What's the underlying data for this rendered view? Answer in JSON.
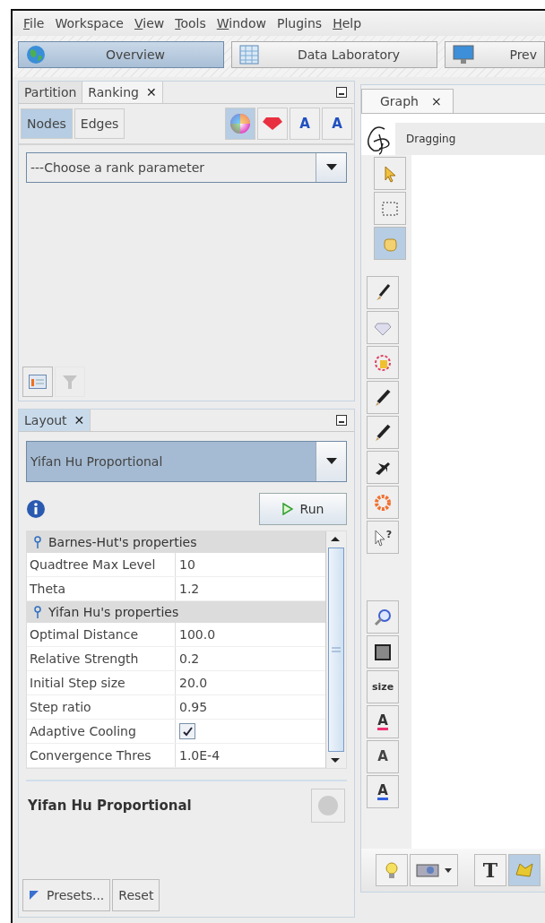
{
  "menu": [
    {
      "label": "File",
      "mnemonic": true
    },
    {
      "label": "Workspace",
      "mnemonic": false
    },
    {
      "label": "View",
      "mnemonic": true
    },
    {
      "label": "Tools",
      "mnemonic": true
    },
    {
      "label": "Window",
      "mnemonic": true
    },
    {
      "label": "Plugins",
      "mnemonic": false
    },
    {
      "label": "Help",
      "mnemonic": true
    }
  ],
  "perspectives": [
    {
      "label": "Overview",
      "kind": "globe",
      "selected": true
    },
    {
      "label": "Data Laboratory",
      "kind": "table",
      "selected": false
    },
    {
      "label": "Prev",
      "kind": "monitor",
      "selected": false
    }
  ],
  "ranking_panel": {
    "tabs": [
      {
        "label": "Partition",
        "selected": false,
        "closable": false
      },
      {
        "label": "Ranking",
        "selected": true,
        "closable": true
      }
    ],
    "close": "✕",
    "element_tabs": [
      {
        "label": "Nodes",
        "selected": true
      },
      {
        "label": "Edges",
        "selected": false
      }
    ],
    "transformers": [
      {
        "kind": "color",
        "selected": true
      },
      {
        "kind": "size",
        "selected": false
      },
      {
        "kind": "label-color",
        "glyph": "A",
        "selected": false
      },
      {
        "kind": "label-size",
        "glyph": "A",
        "selected": false
      }
    ],
    "combo": {
      "value": "---Choose a rank parameter"
    },
    "bottom_buttons": [
      {
        "kind": "list",
        "disabled": false
      },
      {
        "kind": "filter",
        "disabled": true
      }
    ]
  },
  "layout_panel": {
    "tab": {
      "label": "Layout",
      "close": "✕",
      "selected": true
    },
    "combo": {
      "value": "Yifan Hu Proportional"
    },
    "run": "Run",
    "sections": [
      {
        "title": "Barnes-Hut's properties",
        "rows": [
          {
            "kind": "text",
            "name": "Quadtree Max Level",
            "value": "10"
          },
          {
            "kind": "text",
            "name": "Theta",
            "value": "1.2"
          }
        ]
      },
      {
        "title": "Yifan Hu's properties",
        "rows": [
          {
            "kind": "text",
            "name": "Optimal Distance",
            "value": "100.0"
          },
          {
            "kind": "text",
            "name": "Relative Strength",
            "value": "0.2"
          },
          {
            "kind": "text",
            "name": "Initial Step size",
            "value": "20.0"
          },
          {
            "kind": "text",
            "name": "Step ratio",
            "value": "0.95"
          },
          {
            "kind": "checkbox",
            "name": "Adaptive Cooling",
            "checked": true
          },
          {
            "kind": "text",
            "name": "Convergence Thres",
            "value": "1.0E-4"
          }
        ]
      }
    ],
    "description": "Yifan Hu Proportional",
    "presets": "Presets...",
    "reset": "Reset"
  },
  "graph_panel": {
    "tab": {
      "label": "Graph",
      "close": "×",
      "selected": true
    },
    "status": "Dragging",
    "tools": [
      {
        "kind": "pointer",
        "selected": false
      },
      {
        "kind": "rect-select",
        "selected": false
      },
      {
        "kind": "hand",
        "selected": true
      }
    ],
    "edit_tools": [
      {
        "kind": "brush"
      },
      {
        "kind": "diamond"
      },
      {
        "kind": "palette"
      },
      {
        "kind": "pencil"
      },
      {
        "kind": "pencil"
      },
      {
        "kind": "plane"
      },
      {
        "kind": "ring"
      },
      {
        "kind": "help-pointer",
        "glyph": "?"
      }
    ],
    "view_tools": [
      {
        "kind": "zoom"
      },
      {
        "kind": "square"
      },
      {
        "kind": "text",
        "glyph": "size"
      },
      {
        "kind": "font-color",
        "glyph": "A"
      },
      {
        "kind": "font",
        "glyph": "A"
      },
      {
        "kind": "font-size",
        "glyph": "A"
      }
    ],
    "bottom_tools": [
      {
        "kind": "bulb",
        "selected": false
      },
      {
        "kind": "camera",
        "selected": false
      },
      {
        "kind": "text-t",
        "glyph": "T",
        "selected": false
      },
      {
        "kind": "shape",
        "selected": true
      }
    ]
  }
}
